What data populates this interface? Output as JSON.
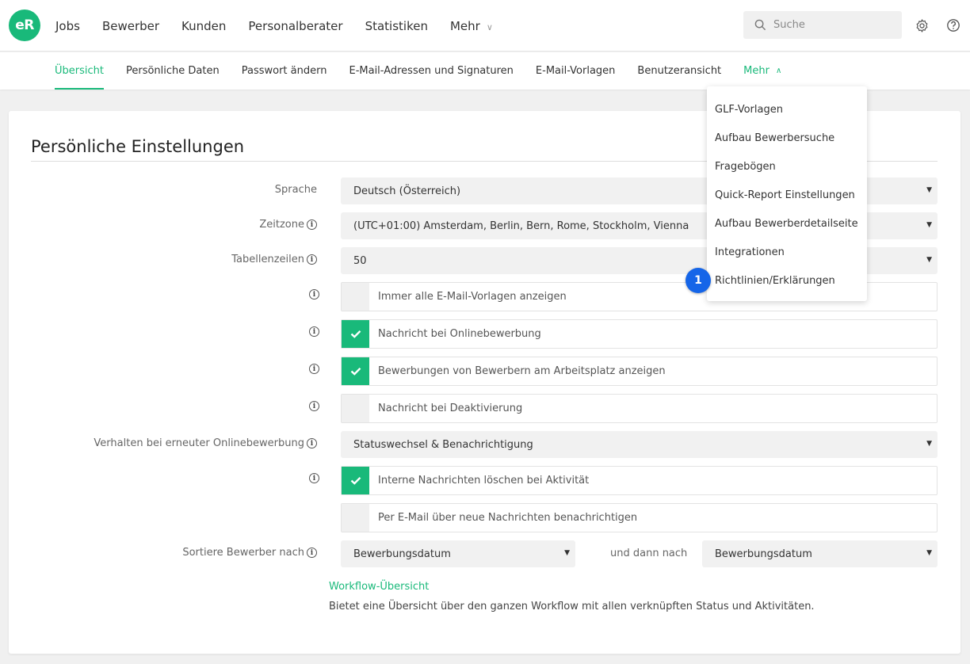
{
  "app": {
    "logo_text": "eR"
  },
  "main_nav": {
    "items": [
      {
        "label": "Jobs"
      },
      {
        "label": "Bewerber"
      },
      {
        "label": "Kunden"
      },
      {
        "label": "Personalberater"
      },
      {
        "label": "Statistiken"
      },
      {
        "label": "Mehr"
      }
    ]
  },
  "search": {
    "placeholder": "Suche"
  },
  "sub_nav": {
    "tabs": [
      {
        "label": "Übersicht",
        "active": true
      },
      {
        "label": "Persönliche Daten"
      },
      {
        "label": "Passwort ändern"
      },
      {
        "label": "E-Mail-Adressen und Signaturen"
      },
      {
        "label": "E-Mail-Vorlagen"
      },
      {
        "label": "Benutzeransicht"
      },
      {
        "label": "Mehr"
      }
    ]
  },
  "page": {
    "title": "Persönliche Einstellungen",
    "settings": {
      "sprache": {
        "label": "Sprache",
        "value": "Deutsch (Österreich)"
      },
      "zeitzone": {
        "label": "Zeitzone",
        "value": "(UTC+01:00) Amsterdam, Berlin, Bern, Rome, Stockholm, Vienna"
      },
      "tabellenzeilen": {
        "label": "Tabellenzeilen",
        "value": "50"
      },
      "checkboxes": [
        {
          "label": "Immer alle E-Mail-Vorlagen anzeigen",
          "checked": false
        },
        {
          "label": "Nachricht bei Onlinebewerbung",
          "checked": true
        },
        {
          "label": "Bewerbungen von Bewerbern am Arbeitsplatz anzeigen",
          "checked": true
        },
        {
          "label": "Nachricht bei Deaktivierung",
          "checked": false
        }
      ],
      "verhalten": {
        "label": "Verhalten bei erneuter Onlinebewerbung",
        "value": "Statuswechsel & Benachrichtigung"
      },
      "checkboxes2": [
        {
          "label": "Interne Nachrichten löschen bei Aktivität",
          "checked": true
        },
        {
          "label": "Per E-Mail über neue Nachrichten benachrichtigen",
          "checked": false
        }
      ],
      "sortiere": {
        "label": "Sortiere Bewerber nach",
        "value1": "Bewerbungsdatum",
        "then_label": "und dann nach",
        "value2": "Bewerbungsdatum"
      }
    },
    "workflow_link": "Workflow-Übersicht",
    "workflow_desc": "Bietet eine Übersicht über den ganzen Workflow mit allen verknüpften Status und Aktivitäten."
  },
  "dropdown": {
    "items": [
      {
        "label": "GLF-Vorlagen"
      },
      {
        "label": "Aufbau Bewerbersuche"
      },
      {
        "label": "Fragebögen"
      },
      {
        "label": "Quick-Report Einstellungen"
      },
      {
        "label": "Aufbau Bewerberdetailseite"
      },
      {
        "label": "Integrationen"
      },
      {
        "label": "Richtlinien/Erklärungen"
      }
    ]
  },
  "annotation": {
    "badge": "1"
  },
  "colors": {
    "accent": "#19b97a",
    "badge": "#1565e8"
  }
}
